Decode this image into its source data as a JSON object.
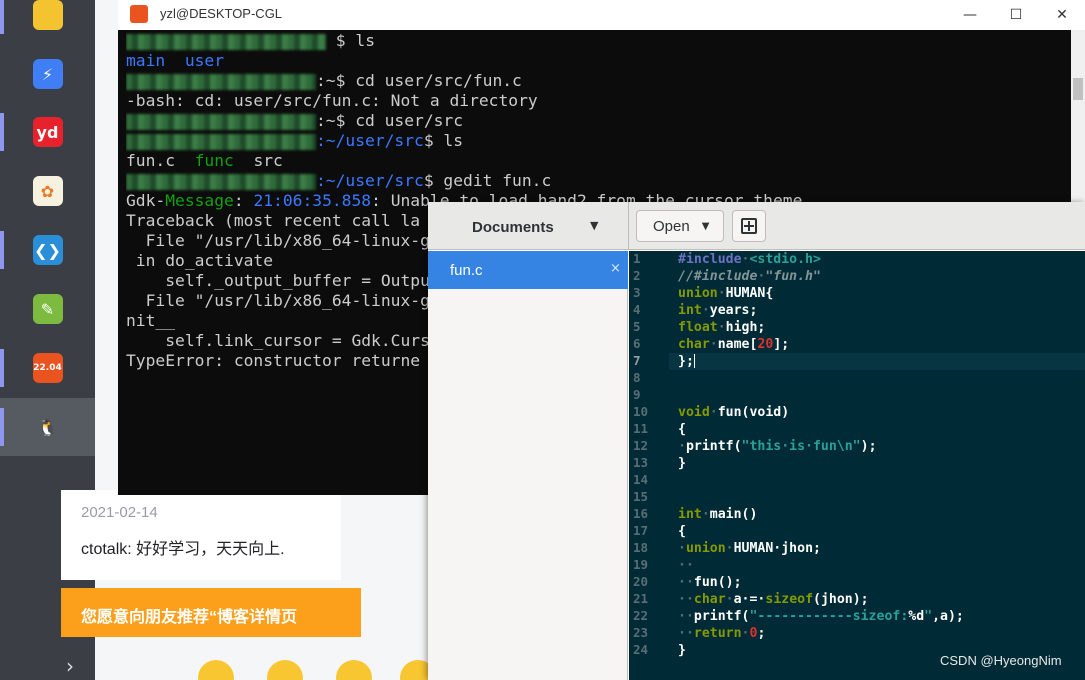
{
  "taskbar": {
    "items": [
      {
        "name": "file-explorer-icon",
        "glyph": "",
        "color": "#f4c430"
      },
      {
        "name": "feishu-icon",
        "glyph": "⚡",
        "color": "#3f7ef5"
      },
      {
        "name": "youdao-icon",
        "glyph": "yd",
        "color": "#e8222c"
      },
      {
        "name": "paint-app-icon",
        "glyph": "✿",
        "color": "#f7f1e0"
      },
      {
        "name": "vscode-icon",
        "glyph": "❮❯",
        "color": "#2b8ed8"
      },
      {
        "name": "notepad-plus-icon",
        "glyph": "✎",
        "color": "#7cbb3f"
      },
      {
        "name": "ubuntu-2204-icon",
        "glyph": "22.04",
        "color": "#e95420"
      },
      {
        "name": "linux-penguin-icon",
        "glyph": "🐧",
        "color": "#ffffff"
      }
    ],
    "more_arrow": "›"
  },
  "blog": {
    "comment_date": "2021-02-14",
    "comment_author": "ctotalk",
    "comment_text": ": 好好学习，天天向上.",
    "recommend_text": "您愿意向朋友推荐“博客详情页"
  },
  "terminal": {
    "title": "yzl@DESKTOP-CGL",
    "buttons": {
      "minimize": "—",
      "maximize": "☐",
      "close": "✕"
    },
    "lines": [
      {
        "blur": 200,
        "text": " $ ls"
      },
      {
        "segments": [
          {
            "t": "main",
            "c": "c-blue"
          },
          {
            "t": "  "
          },
          {
            "t": "user",
            "c": "c-blue"
          }
        ]
      },
      {
        "blur": 190,
        "text": ":~$ cd user/src/fun.c"
      },
      {
        "segments": [
          {
            "t": "-bash: cd: user/src/fun.c: Not a directory"
          }
        ]
      },
      {
        "blur": 190,
        "text": ":~$ cd user/src"
      },
      {
        "blur": 190,
        "path": ":~/user/src",
        "text": "$ ls"
      },
      {
        "segments": [
          {
            "t": "fun.c  "
          },
          {
            "t": "func",
            "c": "c-green"
          },
          {
            "t": "  src"
          }
        ]
      },
      {
        "blur": 190,
        "path": ":~/user/src",
        "text": "$ gedit fun.c"
      },
      {
        "segments": [
          {
            "t": "Gdk-"
          },
          {
            "t": "Message",
            "c": "c-green"
          },
          {
            "t": ": "
          },
          {
            "t": "21:06:35.858",
            "c": "c-blue"
          },
          {
            "t": ": Unable to load hand2 from the cursor theme"
          }
        ]
      },
      {
        "segments": [
          {
            "t": "Traceback (most recent call la"
          }
        ]
      },
      {
        "segments": [
          {
            "t": "  File \"/usr/lib/x86_64-linux-g"
          }
        ]
      },
      {
        "segments": [
          {
            "t": " in do_activate"
          }
        ]
      },
      {
        "segments": [
          {
            "t": "    self._output_buffer = Outpu"
          }
        ]
      },
      {
        "segments": [
          {
            "t": "  File \"/usr/lib/x86_64-linux-g"
          }
        ]
      },
      {
        "segments": [
          {
            "t": "nit__"
          }
        ]
      },
      {
        "segments": [
          {
            "t": "    self.link_cursor = Gdk.Curs"
          }
        ]
      },
      {
        "segments": [
          {
            "t": "TypeError: constructor returne"
          }
        ]
      }
    ]
  },
  "gedit": {
    "documents_label": "Documents",
    "dropdown_arrow": "▼",
    "open_label": "Open",
    "open_arrow": "▼",
    "sidebar_file": "fun.c",
    "sidebar_close": "×",
    "current_line": 7,
    "code_lines": [
      [
        {
          "t": "#include",
          "c": "pp"
        },
        {
          "t": "·",
          "c": "ws"
        },
        {
          "t": "<stdio.h>",
          "c": "str"
        }
      ],
      [
        {
          "t": "//#include",
          "c": "cm"
        },
        {
          "t": "·",
          "c": "ws"
        },
        {
          "t": "\"fun.h\"",
          "c": "cm"
        }
      ],
      [
        {
          "t": "union",
          "c": "kw"
        },
        {
          "t": "·",
          "c": "ws"
        },
        {
          "t": "HUMAN{"
        }
      ],
      [
        {
          "t": "int",
          "c": "ty"
        },
        {
          "t": "·",
          "c": "ws"
        },
        {
          "t": "years;"
        }
      ],
      [
        {
          "t": "float",
          "c": "ty"
        },
        {
          "t": "·",
          "c": "ws"
        },
        {
          "t": "high;"
        }
      ],
      [
        {
          "t": "char",
          "c": "ty"
        },
        {
          "t": "·",
          "c": "ws"
        },
        {
          "t": "name["
        },
        {
          "t": "20",
          "c": "num"
        },
        {
          "t": "];"
        }
      ],
      [
        {
          "t": "};"
        }
      ],
      [],
      [],
      [
        {
          "t": "void",
          "c": "ty"
        },
        {
          "t": "·",
          "c": "ws"
        },
        {
          "t": "fun(void)"
        }
      ],
      [
        {
          "t": "{"
        }
      ],
      [
        {
          "t": "·",
          "c": "ws"
        },
        {
          "t": "printf("
        },
        {
          "t": "\"this·is·fun\\n\"",
          "c": "str"
        },
        {
          "t": ");"
        }
      ],
      [
        {
          "t": "}"
        }
      ],
      [],
      [],
      [
        {
          "t": "int",
          "c": "ty"
        },
        {
          "t": "·",
          "c": "ws"
        },
        {
          "t": "main()"
        }
      ],
      [
        {
          "t": "{"
        }
      ],
      [
        {
          "t": "·",
          "c": "ws"
        },
        {
          "t": "union",
          "c": "kw"
        },
        {
          "t": "·",
          "c": "ws"
        },
        {
          "t": "HUMAN·jhon;"
        }
      ],
      [
        {
          "t": "··",
          "c": "ws"
        }
      ],
      [
        {
          "t": "··",
          "c": "ws"
        },
        {
          "t": "fun();"
        }
      ],
      [
        {
          "t": "··",
          "c": "ws"
        },
        {
          "t": "char",
          "c": "ty"
        },
        {
          "t": "·",
          "c": "ws"
        },
        {
          "t": "a·=·"
        },
        {
          "t": "sizeof",
          "c": "kw"
        },
        {
          "t": "(jhon);"
        }
      ],
      [
        {
          "t": "··",
          "c": "ws"
        },
        {
          "t": "printf("
        },
        {
          "t": "\"------------sizeof:",
          "c": "str"
        },
        {
          "t": "%d"
        },
        {
          "t": "\"",
          "c": "str"
        },
        {
          "t": ",a);"
        }
      ],
      [
        {
          "t": "··",
          "c": "ws"
        },
        {
          "t": "return",
          "c": "kw"
        },
        {
          "t": "·",
          "c": "ws"
        },
        {
          "t": "0",
          "c": "num"
        },
        {
          "t": ";"
        }
      ],
      [
        {
          "t": "}"
        }
      ]
    ]
  },
  "watermark": "CSDN @HyeongNim"
}
